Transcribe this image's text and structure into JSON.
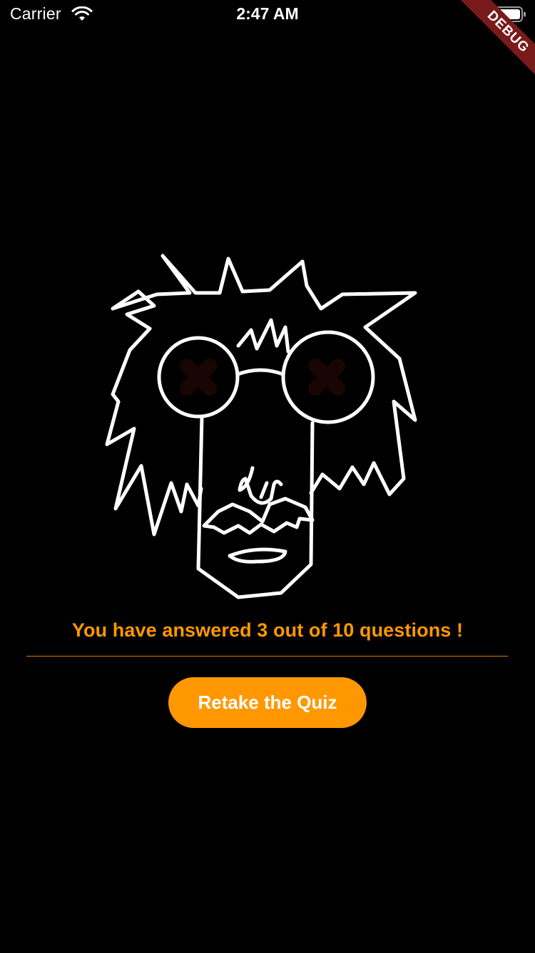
{
  "status_bar": {
    "carrier": "Carrier",
    "time": "2:47 AM",
    "wifi_icon": "wifi-icon",
    "battery_icon": "battery-icon"
  },
  "debug_banner": {
    "label": "DEBUG",
    "color": "#7a1b1b"
  },
  "illustration": {
    "icon": "crazy-scientist-face-icon"
  },
  "result": {
    "message": "You have answered 3 out of 10 questions !",
    "color": "#ff9800"
  },
  "actions": {
    "retake_label": "Retake the Quiz",
    "color": "#ff9800"
  }
}
